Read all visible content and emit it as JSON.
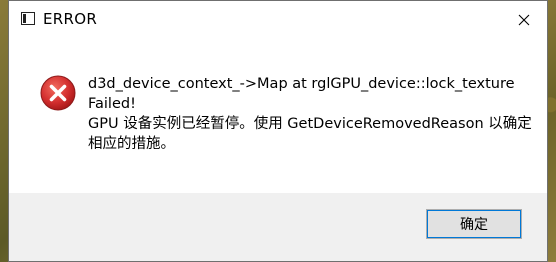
{
  "window": {
    "title": "ERROR",
    "icon": "app-window-icon",
    "close_icon": "close-icon"
  },
  "message": {
    "icon": "error-icon",
    "icon_color": "#d32f2f",
    "lines": [
      "d3d_device_context_->Map at rglGPU_device::lock_texture",
      "Failed!",
      "GPU 设备实例已经暂停。使用 GetDeviceRemovedReason 以确定",
      "相应的措施。"
    ]
  },
  "footer": {
    "ok_label": "确定",
    "accent_color": "#0078d7"
  }
}
